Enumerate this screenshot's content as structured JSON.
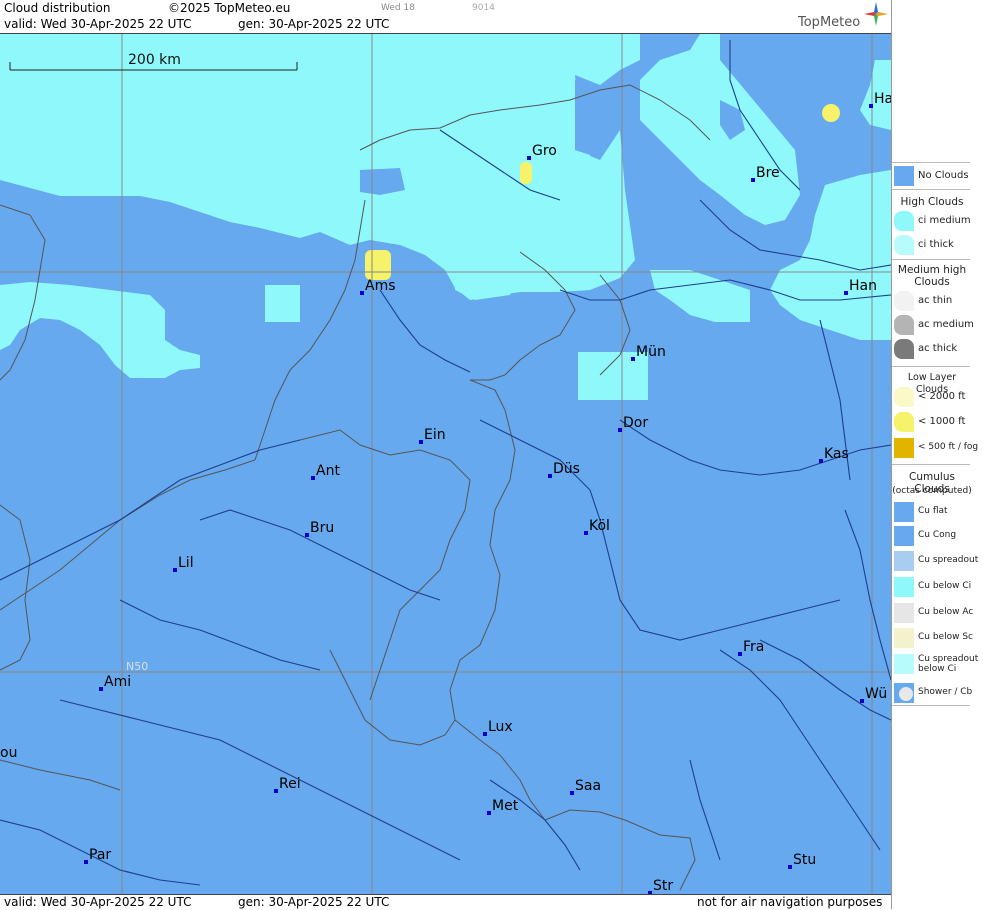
{
  "header": {
    "title": "Cloud distribution",
    "copyright": "©2025 TopMeteo.eu",
    "run_label": "Wed 18",
    "code": "9014",
    "valid": "valid:  Wed  30-Apr-2025  22 UTC",
    "gen": "gen: 30-Apr-2025 22 UTC",
    "logo": "TopMeteo"
  },
  "footer": {
    "valid": "valid:  Wed  30-Apr-2025  22 UTC",
    "gen": "gen: 30-Apr-2025 22 UTC",
    "disclaimer": "not for air navigation purposes"
  },
  "map": {
    "scale_label": "200 km",
    "lat_label": "N50",
    "colors": {
      "no_clouds": "#66a9ee",
      "ci_medium": "#8ff8fa",
      "ci_thick": "#b8fbfc",
      "low_1000": "#f6f36a",
      "border": "#555555",
      "river": "#1d3f8a",
      "grid": "#888888"
    },
    "cities": [
      {
        "name": "Gro"
      },
      {
        "name": "Bre"
      },
      {
        "name": "Ha"
      },
      {
        "name": "Ams"
      },
      {
        "name": "Han"
      },
      {
        "name": "Mün"
      },
      {
        "name": "Dor"
      },
      {
        "name": "Ein"
      },
      {
        "name": "Kas"
      },
      {
        "name": "Ant"
      },
      {
        "name": "Düs"
      },
      {
        "name": "Köl"
      },
      {
        "name": "Bru"
      },
      {
        "name": "Lil"
      },
      {
        "name": "Fra"
      },
      {
        "name": "Ami"
      },
      {
        "name": "Wü"
      },
      {
        "name": "Lux"
      },
      {
        "name": "ou"
      },
      {
        "name": "Rei"
      },
      {
        "name": "Saa"
      },
      {
        "name": "Met"
      },
      {
        "name": "Par"
      },
      {
        "name": "Stu"
      },
      {
        "name": "Str"
      }
    ]
  },
  "legend": {
    "no_clouds": "No Clouds",
    "high_clouds": "High Clouds",
    "ci_medium": "ci medium",
    "ci_thick": "ci thick",
    "medium_high_clouds": "Medium high Clouds",
    "ac_thin": "ac thin",
    "ac_medium": "ac medium",
    "ac_thick": "ac thick",
    "low_layer_clouds": "Low Layer Clouds",
    "lt2000": "< 2000 ft",
    "lt1000": "< 1000 ft",
    "lt500": "< 500 ft / fog",
    "cumulus_clouds": "Cumulus Clouds",
    "octas": "(octas computed)",
    "cu_flat": "Cu flat",
    "cu_cong": "Cu Cong",
    "cu_spreadout": "Cu spreadout",
    "cu_below_ci": "Cu below Ci",
    "cu_below_ac": "Cu below Ac",
    "cu_below_sc": "Cu below Sc",
    "cu_spreadout_below_ci": "Cu spreadout below Ci",
    "shower_cb": "Shower / Cb"
  }
}
